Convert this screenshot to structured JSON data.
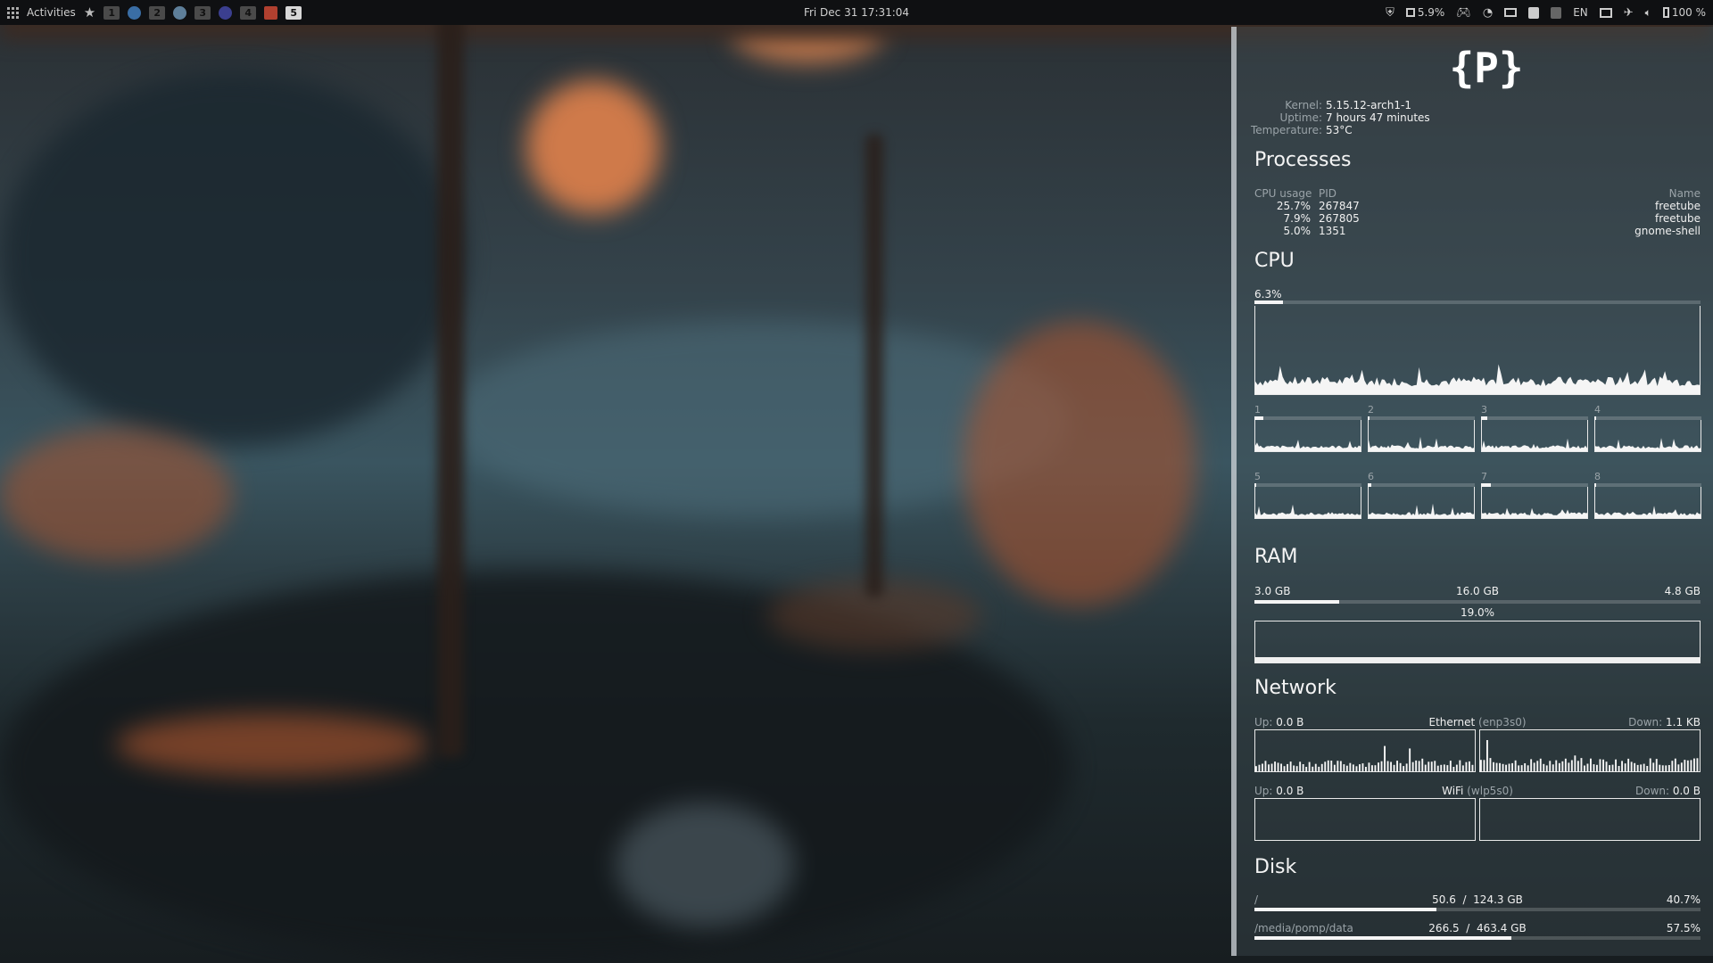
{
  "topbar": {
    "activities": "Activities",
    "workspaces": [
      "1",
      "2",
      "3",
      "4",
      "5"
    ],
    "clock": "Fri Dec 31  17:31:04",
    "cpu_indicator": "5.9%",
    "language": "EN",
    "battery": "100 %"
  },
  "panel": {
    "logo": "{P}",
    "system": {
      "kernel_label": "Kernel:",
      "kernel": "5.15.12-arch1-1",
      "uptime_label": "Uptime:",
      "uptime": "7 hours 47 minutes",
      "temp_label": "Temperature:",
      "temp": "53°C"
    },
    "processes": {
      "title": "Processes",
      "col_cpu": "CPU usage",
      "col_pid": "PID",
      "col_name": "Name",
      "rows": [
        {
          "cpu": "25.7%",
          "pid": "267847",
          "name": "freetube"
        },
        {
          "cpu": "7.9%",
          "pid": "267805",
          "name": "freetube"
        },
        {
          "cpu": "5.0%",
          "pid": "1351",
          "name": "gnome-shell"
        }
      ]
    },
    "cpu": {
      "title": "CPU",
      "total": "6.3%",
      "total_fraction": 0.063,
      "cores": [
        "1",
        "2",
        "3",
        "4",
        "5",
        "6",
        "7",
        "8"
      ],
      "core_fractions": [
        0.08,
        0.01,
        0.06,
        0.02,
        0.01,
        0.03,
        0.09,
        0.02
      ]
    },
    "ram": {
      "title": "RAM",
      "used": "3.0 GB",
      "total": "16.0 GB",
      "free": "4.8 GB",
      "percent": "19.0%",
      "fraction": 0.19
    },
    "network": {
      "title": "Network",
      "up_label": "Up:",
      "down_label": "Down:",
      "eth_up": "0.0 B",
      "eth_name": "Ethernet",
      "eth_iface": "(enp3s0)",
      "eth_down": "1.1 KB",
      "wifi_up": "0.0 B",
      "wifi_name": "WiFi",
      "wifi_iface": "(wlp5s0)",
      "wifi_down": "0.0 B"
    },
    "disk": {
      "title": "Disk",
      "sep": "/",
      "disks": [
        {
          "mount": "/",
          "used": "50.6",
          "size": "124.3 GB",
          "percent": "40.7%",
          "fraction": 0.407
        },
        {
          "mount": "/media/pomp/data",
          "used": "266.5",
          "size": "463.4 GB",
          "percent": "57.5%",
          "fraction": 0.575
        }
      ]
    }
  },
  "colors": {
    "panel_border": "#e6ebf0",
    "graph": "#f5f5f5",
    "bar_bg": "#ffffff2e",
    "accent_orange": "#c8703a"
  }
}
